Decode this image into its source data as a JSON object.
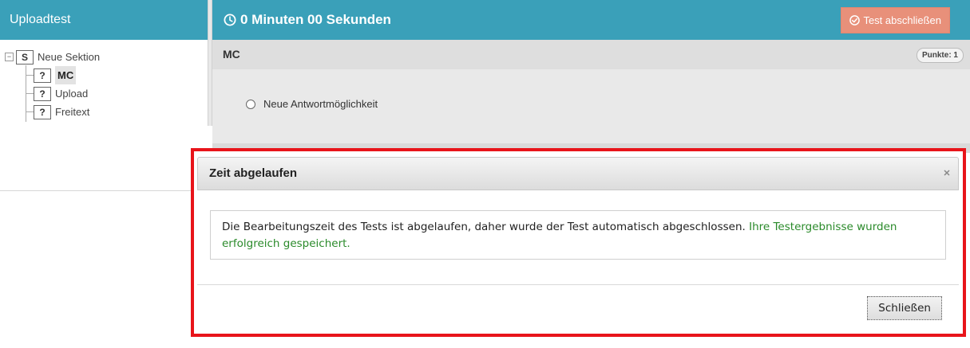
{
  "app": {
    "title": "Uploadtest"
  },
  "tree": {
    "section": {
      "icon_letter": "S",
      "label": "Neue Sektion"
    },
    "items": [
      {
        "icon_letter": "?",
        "label": "MC",
        "active": true
      },
      {
        "icon_letter": "?",
        "label": "Upload",
        "active": false
      },
      {
        "icon_letter": "?",
        "label": "Freitext",
        "active": false
      }
    ]
  },
  "header": {
    "timer_text": "0 Minuten 00 Sekunden",
    "timer_icon": "clock-icon",
    "finish_button_label": "Test abschließen",
    "finish_button_icon": "check-circle-icon"
  },
  "question": {
    "title": "MC",
    "points_badge": "Punkte: 1",
    "options": [
      "Neue Antwortmöglichkeit"
    ]
  },
  "modal": {
    "title": "Zeit abgelaufen",
    "close_icon": "close-icon",
    "message_text": "Die Bearbeitungszeit des Tests ist abgelaufen, daher wurde der Test automatisch abgeschlossen.",
    "message_success": "Ihre Testergebnisse wurden erfolgreich gespeichert.",
    "close_button_label": "Schließen"
  },
  "colors": {
    "header_bg": "#3aa0b9",
    "finish_button_bg": "#e8907a",
    "success_text": "#2a8a2a",
    "highlight_border": "#e8141a"
  }
}
